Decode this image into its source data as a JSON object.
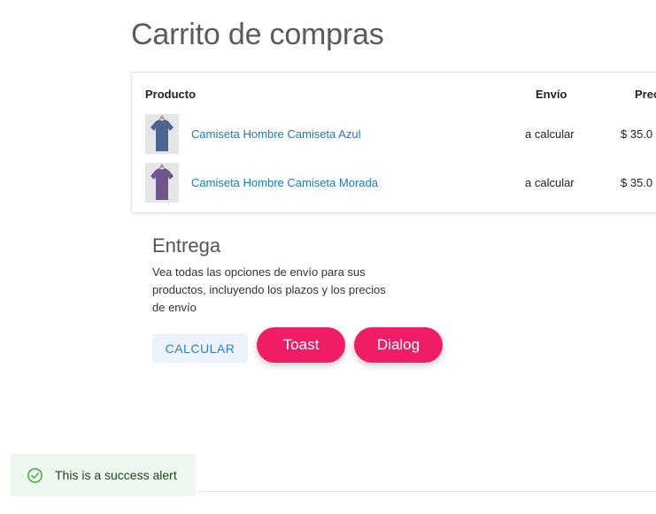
{
  "page": {
    "title": "Carrito de compras"
  },
  "cart": {
    "columns": {
      "product": "Producto",
      "shipping": "Envío",
      "price": "Prec"
    },
    "items": [
      {
        "name": "Camiseta Hombre Camiseta Azul",
        "shipping": "a calcular",
        "price": "$ 35.0",
        "shirt_color": "#4a6590"
      },
      {
        "name": "Camiseta Hombre Camiseta Morada",
        "shipping": "a calcular",
        "price": "$ 35.0",
        "shirt_color": "#6f568c"
      }
    ]
  },
  "delivery": {
    "title": "Entrega",
    "description": "Vea todas las opciones de envío para sus productos, incluyendo los plazos y los precios de envío",
    "calc_button": "CALCULAR"
  },
  "actions": {
    "toast_button": "Toast",
    "dialog_button": "Dialog"
  },
  "alert": {
    "icon": "check-circle-icon",
    "text": "This is a success alert",
    "color": "#4caf50"
  },
  "colors": {
    "accent_pink": "#f01d66",
    "link_blue": "#1a7bc4"
  }
}
